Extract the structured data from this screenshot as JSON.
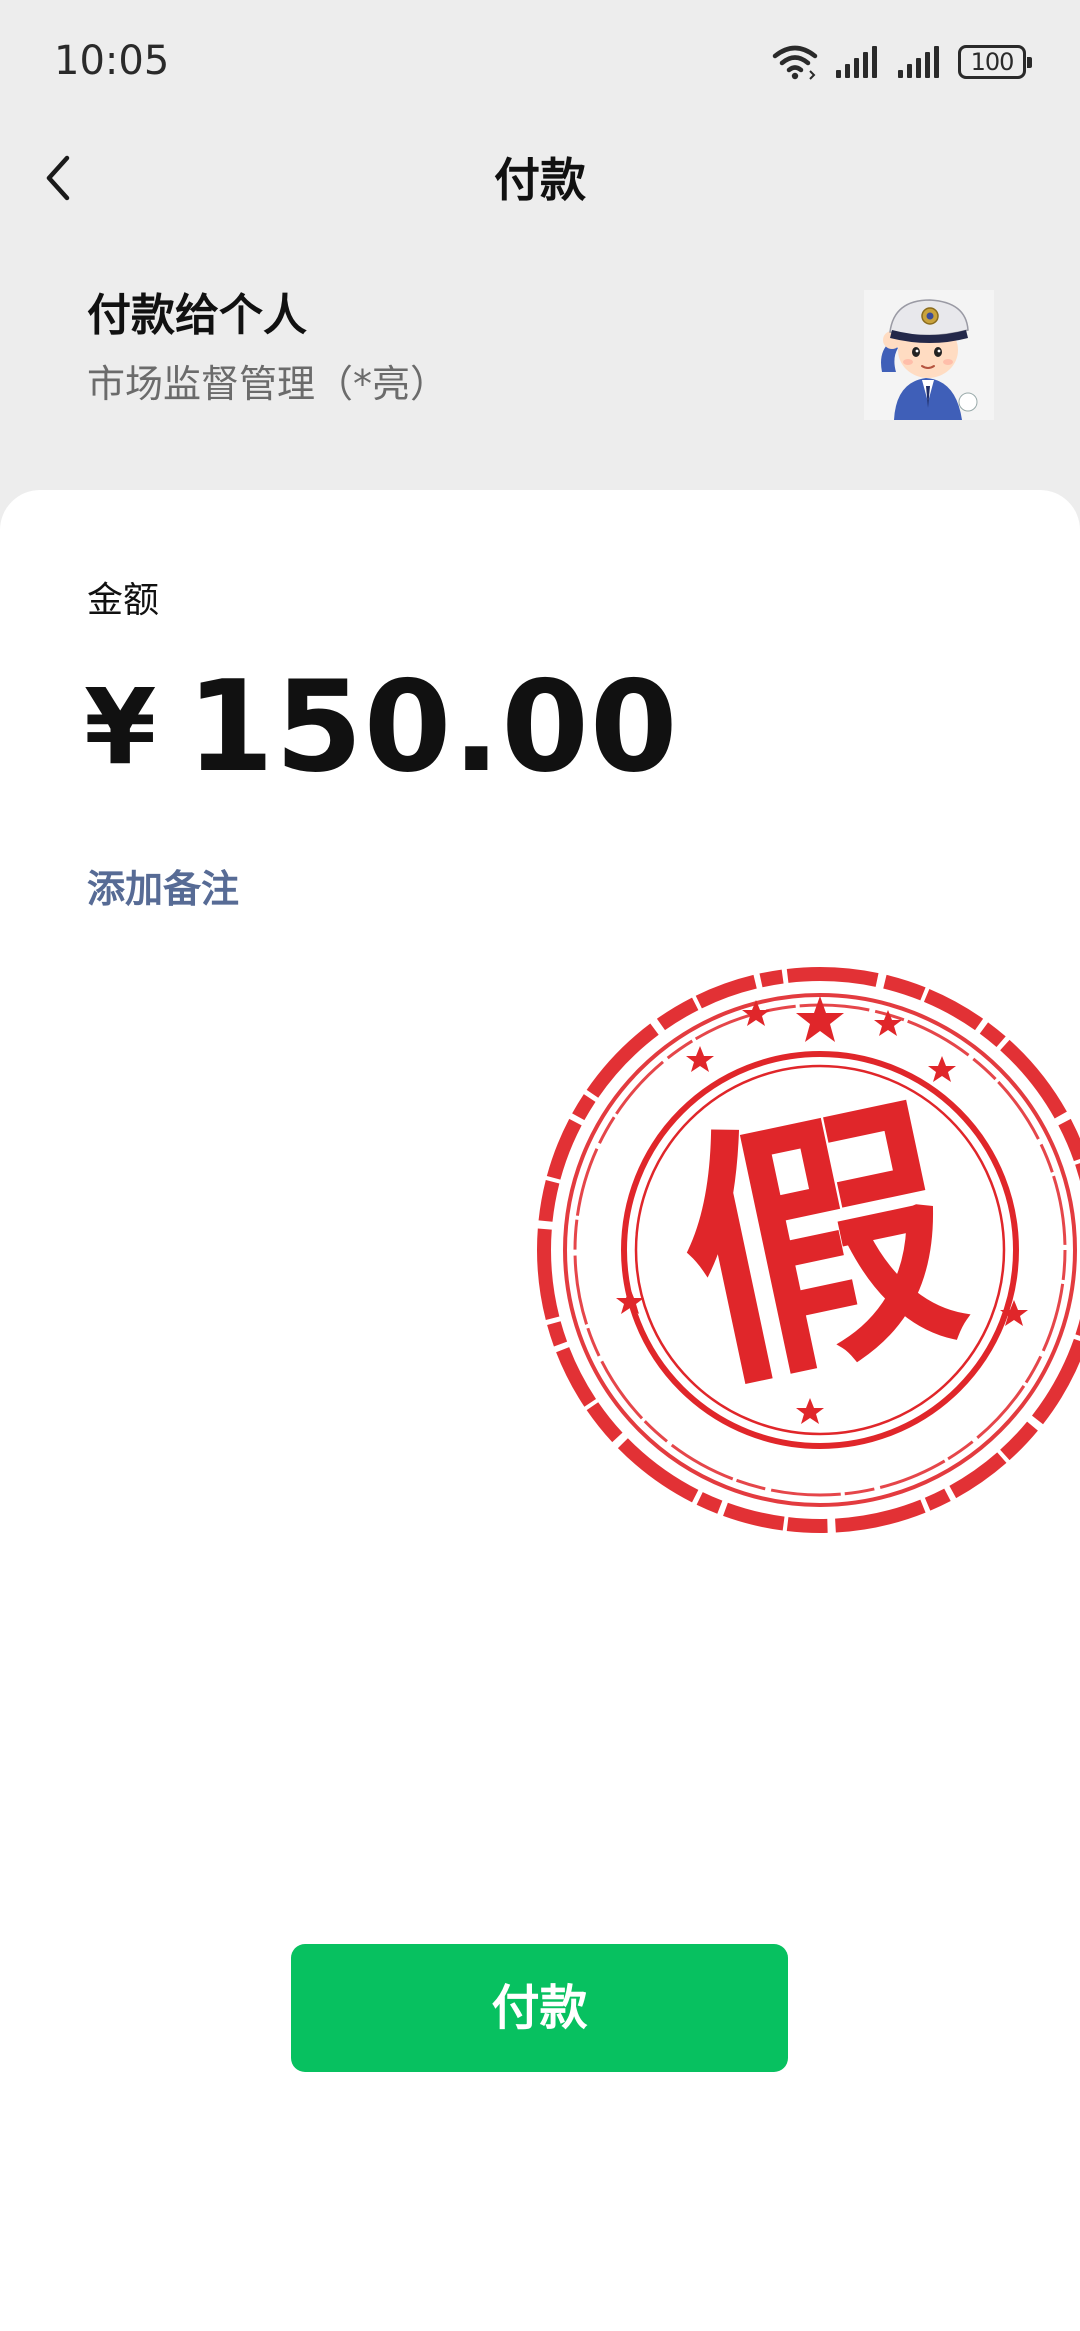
{
  "status_bar": {
    "time": "10:05",
    "battery": "100",
    "icons": [
      "wifi-icon",
      "signal-icon",
      "signal-icon",
      "battery-icon"
    ]
  },
  "nav": {
    "back_icon": "chevron-left-icon",
    "title": "付款"
  },
  "payee": {
    "heading": "付款给个人",
    "name": "市场监督管理（*亮）",
    "avatar_icon": "police-officer-avatar"
  },
  "amount": {
    "label": "金额",
    "currency": "¥",
    "value": "150.00"
  },
  "note": {
    "label": "添加备注"
  },
  "stamp": {
    "text": "假",
    "color": "#e0262a"
  },
  "pay_button": {
    "label": "付款",
    "color": "#07c160"
  }
}
